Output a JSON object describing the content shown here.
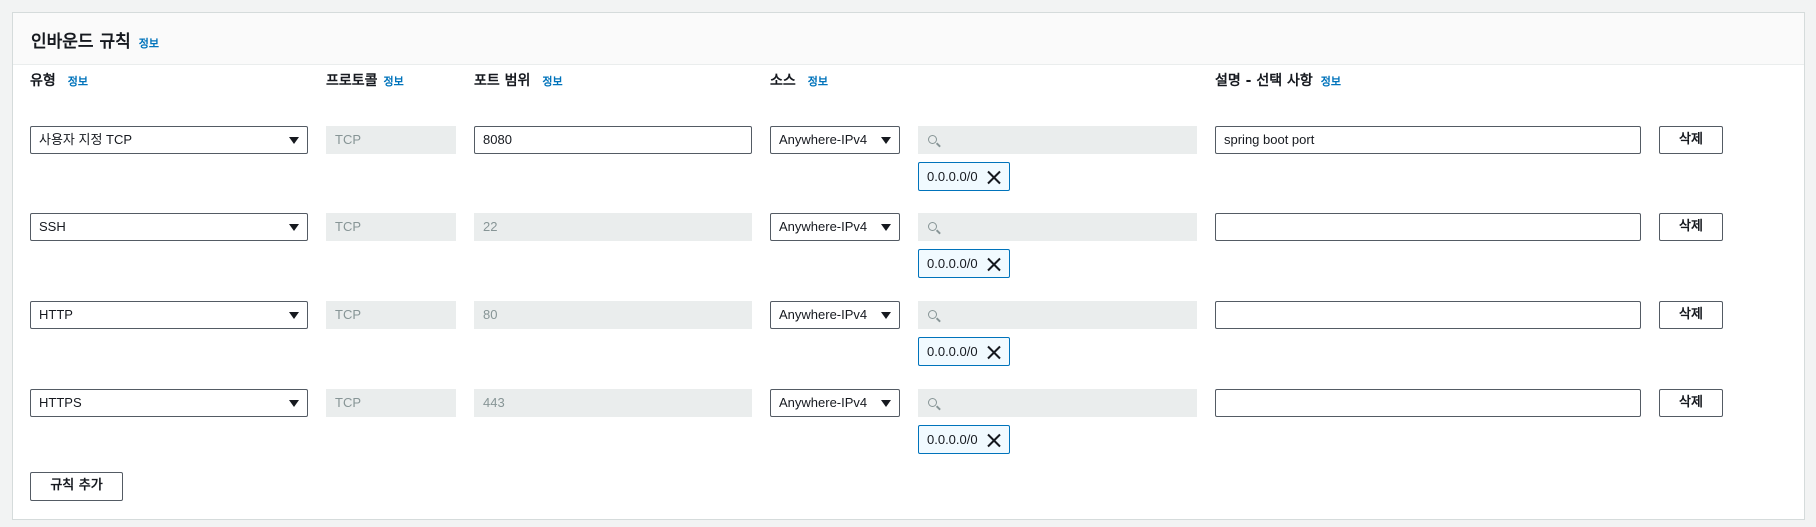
{
  "panel": {
    "title": "인바운드 규칙",
    "info_label": "정보"
  },
  "columns": {
    "type": "유형",
    "protocol": "프로토콜",
    "port_range": "포트 범위",
    "source": "소스",
    "description": "설명 - 선택 사항",
    "info_label": "정보"
  },
  "rules": [
    {
      "type": "사용자 지정 TCP",
      "protocol": "TCP",
      "port_range": "8080",
      "port_editable": true,
      "source_type": "Anywhere-IPv4",
      "source_search_placeholder": "",
      "cidr_token": "0.0.0.0/0",
      "description": "spring boot port",
      "delete_label": "삭제"
    },
    {
      "type": "SSH",
      "protocol": "TCP",
      "port_range": "22",
      "port_editable": false,
      "source_type": "Anywhere-IPv4",
      "source_search_placeholder": "",
      "cidr_token": "0.0.0.0/0",
      "description": "",
      "delete_label": "삭제"
    },
    {
      "type": "HTTP",
      "protocol": "TCP",
      "port_range": "80",
      "port_editable": false,
      "source_type": "Anywhere-IPv4",
      "source_search_placeholder": "",
      "cidr_token": "0.0.0.0/0",
      "description": "",
      "delete_label": "삭제"
    },
    {
      "type": "HTTPS",
      "protocol": "TCP",
      "port_range": "443",
      "port_editable": false,
      "source_type": "Anywhere-IPv4",
      "source_search_placeholder": "",
      "cidr_token": "0.0.0.0/0",
      "description": "",
      "delete_label": "삭제"
    }
  ],
  "add_rule_label": "규칙 추가",
  "colors": {
    "info_link": "#0073bb",
    "token_border": "#0073bb",
    "token_bg": "#f1faff",
    "disabled_bg": "#eaeded"
  }
}
